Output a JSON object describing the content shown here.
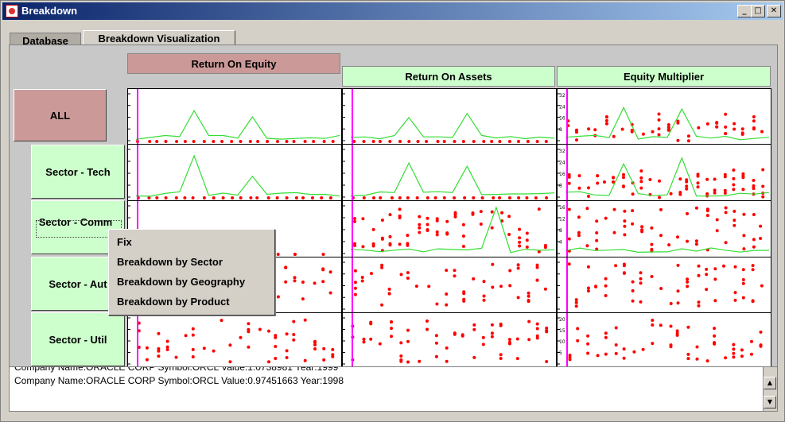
{
  "window": {
    "title": "Breakdown",
    "minimize": "_",
    "maximize": "□",
    "close": "✕"
  },
  "tabs": [
    {
      "label": "Database",
      "active": false
    },
    {
      "label": "Breakdown Visualization",
      "active": true
    }
  ],
  "columns": [
    {
      "label": "Return On Equity",
      "color": "#cc9999"
    },
    {
      "label": "Return On Assets",
      "color": "#ccffcc"
    },
    {
      "label": "Equity Multiplier",
      "color": "#ccffcc"
    }
  ],
  "rows": [
    {
      "label": "ALL",
      "color": "#cc9999"
    },
    {
      "label": "Sector - Tech",
      "color": "#ccffcc"
    },
    {
      "label": "Sector - Comm",
      "color": "#ccffcc"
    },
    {
      "label": "Sector - Aut",
      "color": "#ccffcc"
    },
    {
      "label": "Sector - Util",
      "color": "#ccffcc"
    }
  ],
  "context_menu": {
    "items": [
      "Fix",
      "Breakdown by Sector",
      "Breakdown by Geography",
      "Breakdown by Product"
    ]
  },
  "log": {
    "lines": [
      "Company Name:ORACLE CORP Symbol:ORCL Value:1.0738981 Year:1999",
      "Company Name:ORACLE CORP Symbol:ORCL Value:0.97451663 Year:1998"
    ]
  },
  "colors": {
    "point": "#ff0000",
    "line": "#33dd33",
    "marker": "#ff00ff"
  },
  "axis_ticks": {
    "em_all": [
      "32",
      "24",
      "16",
      "8"
    ],
    "em_tech": [
      "32",
      "24",
      "16",
      "8"
    ],
    "em_comm": [
      "16",
      "12",
      "8",
      "4"
    ],
    "em_util": [
      "20",
      "15",
      "10",
      "5"
    ]
  }
}
